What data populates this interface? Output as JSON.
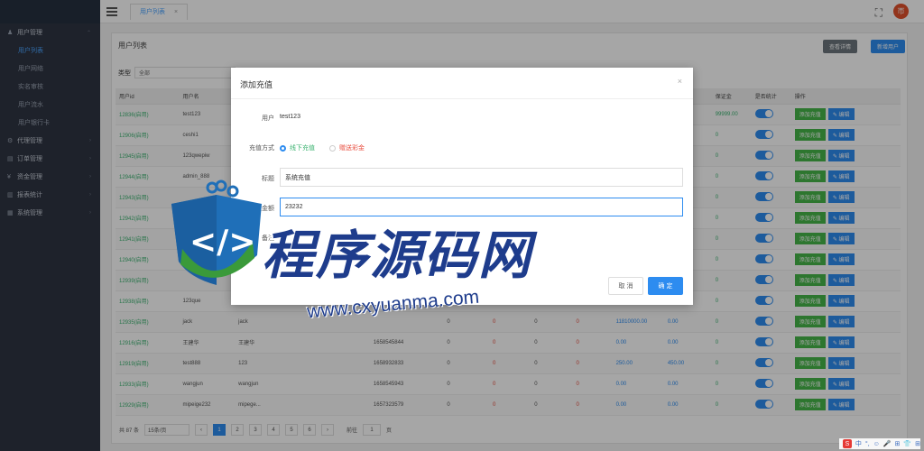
{
  "header": {
    "tab_label": "用户列表",
    "tab_close": "×",
    "fullscreen_icon": "⛶",
    "avatar_text": "帀"
  },
  "sidebar": {
    "groups": [
      {
        "label": "用户管理",
        "icon": "user-icon"
      },
      {
        "label": "代理管理",
        "icon": "agent-icon"
      },
      {
        "label": "订单管理",
        "icon": "order-icon"
      },
      {
        "label": "资金管理",
        "icon": "fund-icon"
      },
      {
        "label": "报表统计",
        "icon": "report-icon"
      },
      {
        "label": "系统管理",
        "icon": "settings-icon"
      }
    ],
    "items": [
      {
        "label": "用户列表",
        "active": true
      },
      {
        "label": "用户网络"
      },
      {
        "label": "实名审核"
      },
      {
        "label": "用户流水"
      },
      {
        "label": "用户银行卡"
      }
    ]
  },
  "main": {
    "title": "用户列表",
    "buttons": {
      "gray": "查看详情",
      "blue": "新增用户"
    },
    "filter_label": "类型",
    "filter_value": "全部",
    "columns": [
      "用户id",
      "用户名",
      "",
      "",
      "",
      "",
      "",
      "",
      "",
      "保证金",
      "是否统计",
      "操作"
    ],
    "rows": [
      {
        "id": "12836",
        "tag": "(启用)",
        "name": "test123",
        "c2": "",
        "phone": "",
        "deposit": "99999.00"
      },
      {
        "id": "12906",
        "tag": "(启用)",
        "name": "ceshi1",
        "c2": "",
        "phone": "",
        "deposit": "0"
      },
      {
        "id": "12945",
        "tag": "(启用)",
        "name": "123qwepiw",
        "c2": "",
        "phone": "",
        "deposit": "0"
      },
      {
        "id": "12944",
        "tag": "(启用)",
        "name": "admin_888",
        "c2": "",
        "phone": "",
        "deposit": "0"
      },
      {
        "id": "12943",
        "tag": "(启用)",
        "name": "",
        "c2": "",
        "phone": "",
        "deposit": "0"
      },
      {
        "id": "12942",
        "tag": "(启用)",
        "name": "",
        "c2": "",
        "phone": "",
        "deposit": "0"
      },
      {
        "id": "12941",
        "tag": "(启用)",
        "name": "",
        "c2": "",
        "phone": "",
        "deposit": "0"
      },
      {
        "id": "12940",
        "tag": "(启用)",
        "name": "",
        "c2": "",
        "phone": "",
        "deposit": "0"
      },
      {
        "id": "12939",
        "tag": "(启用)",
        "name": "",
        "c2": "",
        "phone": "",
        "deposit": "0"
      },
      {
        "id": "12938",
        "tag": "(启用)",
        "name": "123que",
        "c2": "",
        "phone": "",
        "deposit": "0"
      },
      {
        "id": "12935",
        "tag": "(启用)",
        "name": "jack",
        "c2": "jack",
        "phone": "",
        "deposit": "0",
        "v1": "0",
        "v2": "0",
        "v3": "0",
        "v4": "0",
        "v5": "11810000.00",
        "v6": "0.00"
      },
      {
        "id": "12916",
        "tag": "(启用)",
        "name": "王建华",
        "c2": "王建华",
        "phone": "1658545844",
        "deposit": "0",
        "v1": "0",
        "v2": "0",
        "v3": "0",
        "v4": "0",
        "v5": "0.00",
        "v6": "0.00"
      },
      {
        "id": "12919",
        "tag": "(启用)",
        "name": "test888",
        "c2": "123",
        "phone": "1658932833",
        "deposit": "0",
        "v1": "0",
        "v2": "0",
        "v3": "0",
        "v4": "0",
        "v5": "250.00",
        "v6": "450.00"
      },
      {
        "id": "12933",
        "tag": "(启用)",
        "name": "wangjun",
        "c2": "wangjun",
        "phone": "1658545943",
        "deposit": "0",
        "v1": "0",
        "v2": "0",
        "v3": "0",
        "v4": "0",
        "v5": "0.00",
        "v6": "0.00"
      },
      {
        "id": "12929",
        "tag": "(启用)",
        "name": "mipeige232",
        "c2": "mipege...",
        "phone": "1657323579",
        "deposit": "0",
        "v1": "0",
        "v2": "0",
        "v3": "0",
        "v4": "0",
        "v5": "0.00",
        "v6": "0.00"
      }
    ],
    "op_recharge": "添加充值",
    "op_edit": "✎ 编辑",
    "pager": {
      "total": "共 87 条",
      "per_page": "15条/页",
      "prev": "‹",
      "pages": [
        "1",
        "2",
        "3",
        "4",
        "5",
        "6"
      ],
      "next": "›",
      "goto": "前往",
      "goto_value": "1",
      "page_unit": "页"
    }
  },
  "modal": {
    "title": "添加充值",
    "close": "×",
    "user_label": "用户",
    "user_value": "test123",
    "method_label": "充值方式",
    "method_on": "线下充值",
    "method_off": "赠送彩金",
    "subject_label": "标题",
    "subject_value": "系统充值",
    "amount_label": "充值金额",
    "amount_value": "23232",
    "note_label": "备注",
    "cancel": "取 消",
    "ok": "确 定"
  },
  "watermark": {
    "title": "程序源码网",
    "url": "www.cxyuanma.com"
  },
  "taskbar": {
    "s": "S",
    "items": [
      "中",
      "°,",
      "☺",
      "🎤",
      "⊞",
      "👕",
      "⊞"
    ]
  },
  "colors": {
    "accent": "#2d8cf0",
    "success": "#45b649",
    "danger": "#e84c3d",
    "sidebar": "#2f3542"
  }
}
